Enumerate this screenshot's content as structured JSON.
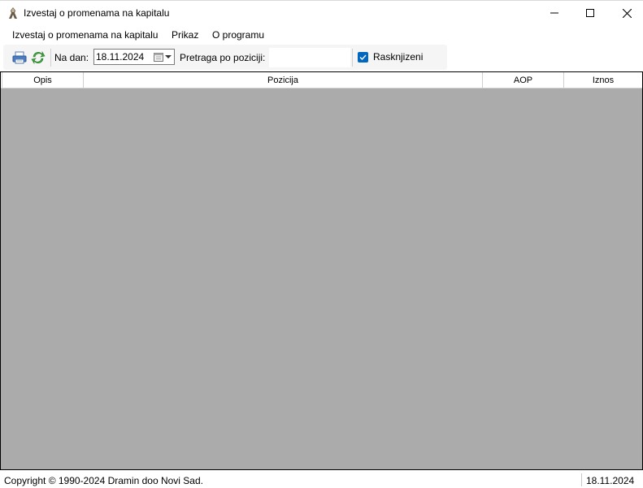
{
  "window": {
    "title": "Izvestaj o promenama na kapitalu",
    "icon": "app-person-icon"
  },
  "menu": {
    "items": [
      {
        "label": "Izvestaj o promenama na kapitalu"
      },
      {
        "label": "Prikaz"
      },
      {
        "label": "O programu"
      }
    ]
  },
  "toolbar": {
    "print_icon": "printer-icon",
    "refresh_icon": "refresh-icon",
    "date_label": "Na dan:",
    "date_value": "18.11.2024",
    "search_label": "Pretraga po poziciji:",
    "search_value": "",
    "checkbox_label": "Rasknjizeni",
    "checkbox_checked": true
  },
  "grid": {
    "columns": [
      "Opis",
      "Pozicija",
      "AOP",
      "Iznos"
    ],
    "rows": []
  },
  "status": {
    "copyright": "Copyright © 1990-2024 Dramin doo Novi Sad.",
    "date": "18.11.2024"
  },
  "colors": {
    "grid_background": "#ababab",
    "checkbox_accent": "#0067c0"
  }
}
